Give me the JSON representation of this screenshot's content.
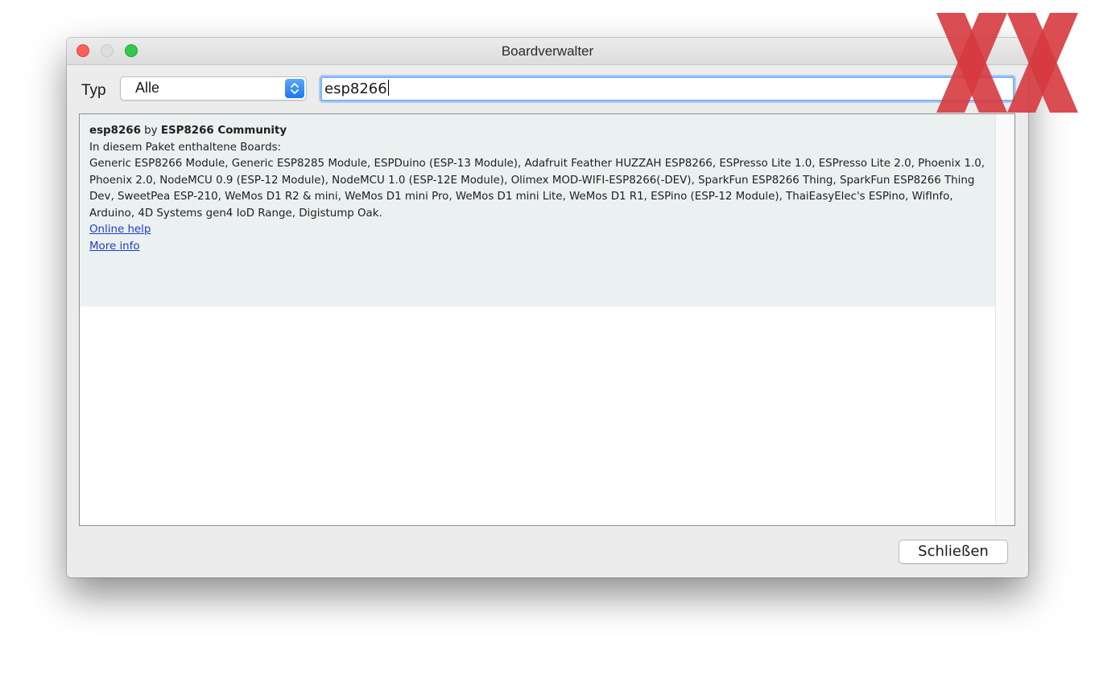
{
  "window": {
    "title": "Boardverwalter"
  },
  "filter": {
    "type_label": "Typ",
    "type_value": "Alle",
    "search_value": "esp8266"
  },
  "board": {
    "name": "esp8266",
    "by": " by ",
    "author": "ESP8266 Community",
    "boards_heading": "In diesem Paket enthaltene Boards:",
    "boards_list": "Generic ESP8266 Module, Generic ESP8285 Module, ESPDuino (ESP-13 Module), Adafruit Feather HUZZAH ESP8266, ESPresso Lite 1.0, ESPresso Lite 2.0, Phoenix 1.0, Phoenix 2.0, NodeMCU 0.9 (ESP-12 Module), NodeMCU 1.0 (ESP-12E Module), Olimex MOD-WIFI-ESP8266(-DEV), SparkFun ESP8266 Thing, SparkFun ESP8266 Thing Dev, SweetPea ESP-210, WeMos D1 R2 & mini, WeMos D1 mini Pro, WeMos D1 mini Lite, WeMos D1 R1, ESPino (ESP-12 Module), ThaiEasyElec's ESPino, WifInfo, Arduino, 4D Systems gen4 IoD Range, Digistump Oak.",
    "online_help": "Online help",
    "more_info": "More info"
  },
  "footer": {
    "close_label": "Schließen"
  },
  "icons": {
    "traffic_close": "close-traffic-light-icon",
    "traffic_minimize": "minimize-traffic-light-icon",
    "traffic_zoom": "zoom-traffic-light-icon",
    "select_stepper": "chevron-up-down-icon",
    "watermark": "xx-logo"
  },
  "colors": {
    "accent": "#1a78f1",
    "link": "#1d3ec9",
    "entry_background": "#ebf0f0",
    "watermark": "#d63a3f"
  }
}
